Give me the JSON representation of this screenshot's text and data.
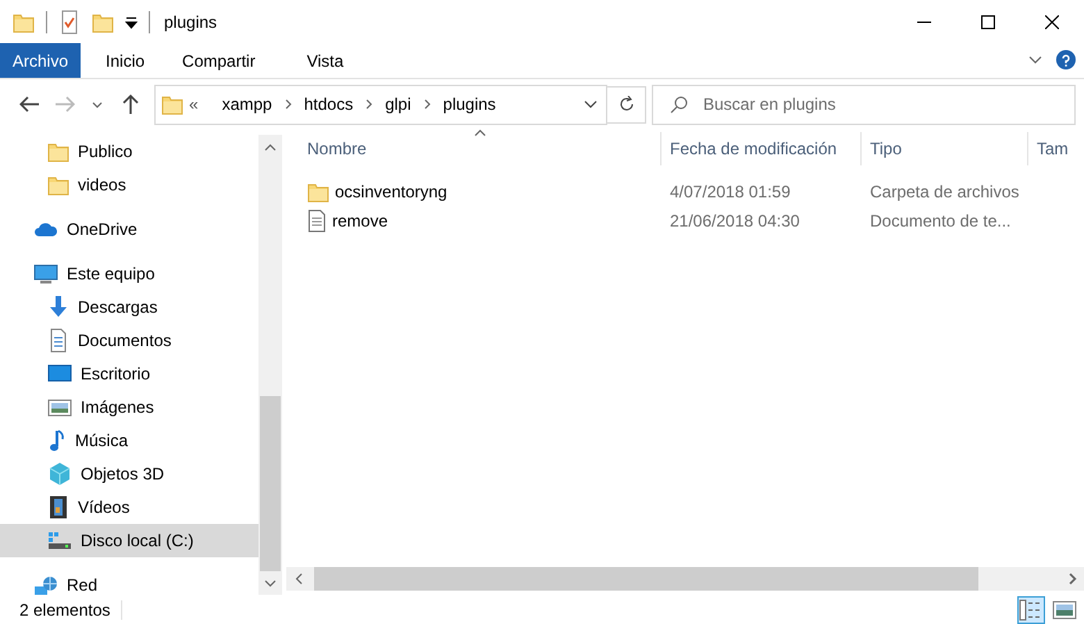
{
  "window": {
    "title": "plugins"
  },
  "ribbon": {
    "tabs": [
      {
        "label": "Archivo",
        "kind": "file",
        "selected": false
      },
      {
        "label": "Inicio",
        "kind": "tab",
        "selected": false
      },
      {
        "label": "Compartir",
        "kind": "tab",
        "selected": false
      },
      {
        "label": "Vista",
        "kind": "tab",
        "selected": false
      }
    ]
  },
  "address": {
    "overflow": "«",
    "parts": [
      "xampp",
      "htdocs",
      "glpi",
      "plugins"
    ]
  },
  "search": {
    "placeholder": "Buscar en plugins"
  },
  "sidebar": {
    "items": [
      {
        "children": [
          {
            "label": "Publico",
            "kind": "folder",
            "selected": false
          },
          {
            "label": "videos",
            "kind": "folder",
            "selected": false
          }
        ]
      },
      {
        "label": "OneDrive",
        "kind": "cloud",
        "selected": false
      },
      {
        "label": "Este equipo",
        "kind": "pc",
        "selected": false,
        "children": [
          {
            "label": "Descargas",
            "kind": "download",
            "selected": false
          },
          {
            "label": "Documentos",
            "kind": "document",
            "selected": false
          },
          {
            "label": "Escritorio",
            "kind": "desktop",
            "selected": false
          },
          {
            "label": "Imágenes",
            "kind": "image",
            "selected": false
          },
          {
            "label": "Música",
            "kind": "music",
            "selected": false
          },
          {
            "label": "Objetos 3D",
            "kind": "cube",
            "selected": false
          },
          {
            "label": "Vídeos",
            "kind": "film",
            "selected": false
          },
          {
            "label": "Disco local (C:)",
            "kind": "drive",
            "selected": true
          }
        ]
      },
      {
        "label": "Red",
        "kind": "network",
        "selected": false
      }
    ]
  },
  "table": {
    "columns": [
      "Nombre",
      "Fecha de modificación",
      "Tipo",
      "Tam"
    ],
    "rows": [
      {
        "kind": "folder",
        "name": "ocsinventoryng",
        "date": "4/07/2018 01:59",
        "type": "Carpeta de archivos"
      },
      {
        "kind": "file",
        "name": "remove",
        "date": "21/06/2018 04:30",
        "type": "Documento de te..."
      }
    ]
  },
  "status_bar": {
    "text": "2 elementos",
    "views": [
      {
        "kind": "details",
        "selected": true
      },
      {
        "kind": "large",
        "selected": false
      }
    ]
  }
}
